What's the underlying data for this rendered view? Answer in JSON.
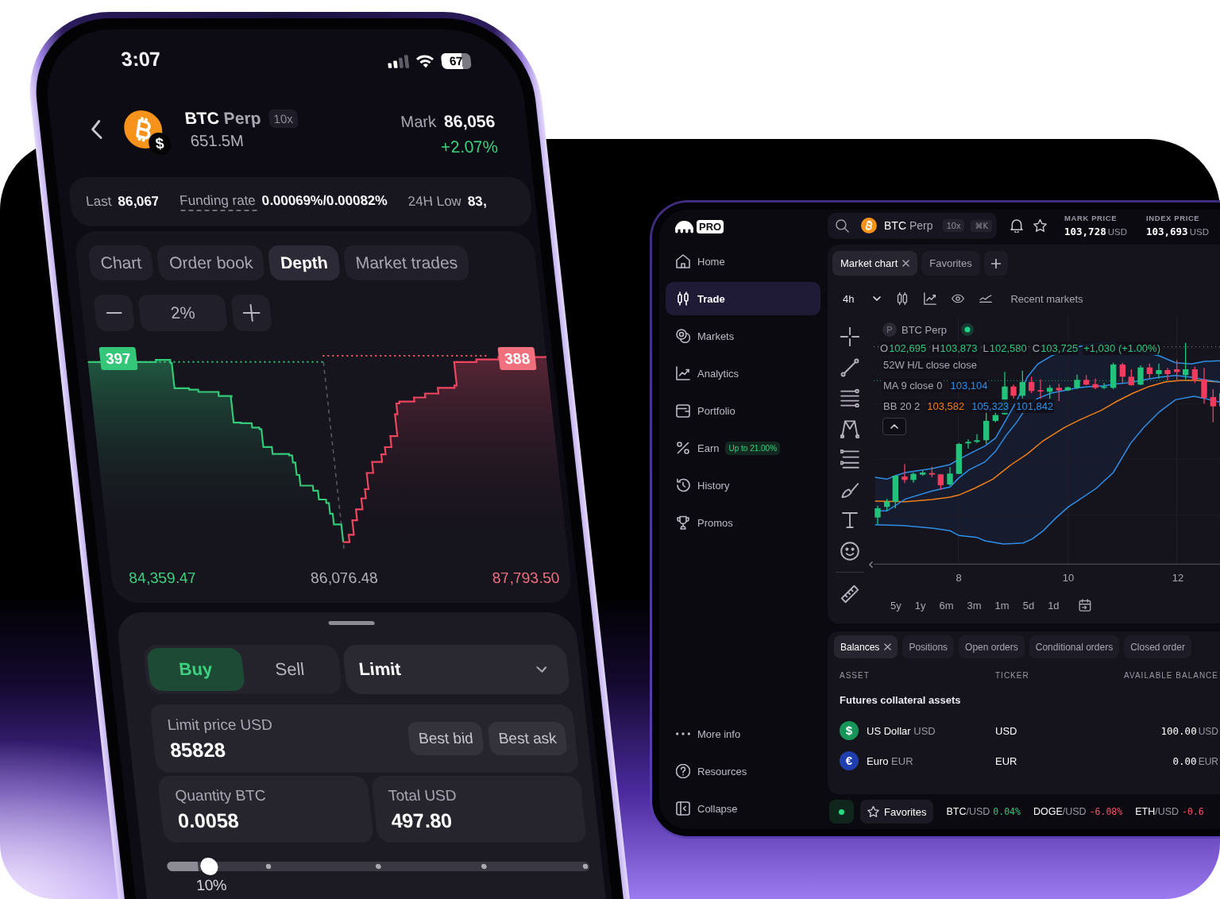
{
  "phone": {
    "status_bar": {
      "time": "3:07",
      "battery": "67"
    },
    "header": {
      "base": "BTC",
      "quote": "Perp",
      "coin_badge": "$",
      "leverage": "10x",
      "volume": "651.5M",
      "mark_label": "Mark",
      "mark_value": "86,056",
      "change": {
        "text": "+2.07%",
        "positive": true
      }
    },
    "stats": [
      {
        "label": "Last",
        "value": "86,067",
        "underlined": false
      },
      {
        "label": "Funding rate",
        "value": "0.00069%/0.00082%",
        "underlined": true
      },
      {
        "label": "24H Low",
        "value": "83,",
        "underlined": false
      }
    ],
    "tabs": [
      {
        "label": "Chart",
        "selected": false
      },
      {
        "label": "Order book",
        "selected": false
      },
      {
        "label": "Depth",
        "selected": true
      },
      {
        "label": "Market trades",
        "selected": false
      }
    ],
    "depth_step": "2%",
    "depth_chart": {
      "bid_label": "397",
      "ask_label": "388",
      "low_price": "84,359.47",
      "mid_price": "86,076.48",
      "high_price": "87,793.50"
    },
    "order_form": {
      "sides": [
        {
          "label": "Buy",
          "kind": "buy",
          "selected": true
        },
        {
          "label": "Sell",
          "kind": "sell",
          "selected": false
        }
      ],
      "order_type": "Limit",
      "limit_price": {
        "label": "Limit price USD",
        "value": "85828",
        "buttons": [
          "Best bid",
          "Best ask"
        ]
      },
      "quantity": {
        "label": "Quantity BTC",
        "value": "0.0058"
      },
      "total": {
        "label": "Total USD",
        "value": "497.80"
      },
      "size_slider": {
        "level": 0.1,
        "reading": "10%"
      }
    }
  },
  "terminal": {
    "logo": {
      "badge": "PRO"
    },
    "sidebar": {
      "items": [
        {
          "label": "Home",
          "selected": false
        },
        {
          "label": "Trade",
          "selected": true
        },
        {
          "label": "Markets",
          "selected": false
        },
        {
          "label": "Analytics",
          "selected": false
        },
        {
          "label": "Portfolio",
          "selected": false
        },
        {
          "label": "Earn",
          "selected": false,
          "badge": "Up to 21.00%"
        },
        {
          "label": "History",
          "selected": false
        },
        {
          "label": "Promos",
          "selected": false
        }
      ],
      "footer_items": [
        "More info",
        "Resources",
        "Collapse"
      ]
    },
    "search": {
      "base": "BTC",
      "quote": "Perp",
      "leverage": "10x",
      "shortcut": "⌘K"
    },
    "prices": [
      {
        "label": "MARK PRICE",
        "value": "103,728",
        "unit": "USD"
      },
      {
        "label": "INDEX PRICE",
        "value": "103,693",
        "unit": "USD"
      }
    ],
    "chart_panel": {
      "tabs": [
        {
          "label": "Market chart",
          "selected": true,
          "closable": true
        },
        {
          "label": "Favorites",
          "selected": false,
          "closable": false
        }
      ],
      "interval": "4h",
      "recent_markets": "Recent markets",
      "legend": {
        "badge": "P",
        "symbol": "BTC Perp",
        "positive": true,
        "ohlc": [
          {
            "key": "O",
            "value": "102,695"
          },
          {
            "key": "H",
            "value": "103,873"
          },
          {
            "key": "L",
            "value": "102,580"
          },
          {
            "key": "C",
            "value": "103,725"
          }
        ],
        "change": "+1,030 (+1.00%)",
        "lines": [
          {
            "label": "52W H/L close close"
          },
          {
            "label": "MA 9 close 0",
            "values": [
              {
                "text": "103,104",
                "color": "#2f8ee6"
              }
            ]
          },
          {
            "label": "BB 20 2",
            "values": [
              {
                "text": "103,582",
                "color": "#f07f1a"
              },
              {
                "text": "105,323",
                "color": "#2f8ee6"
              },
              {
                "text": "101,842",
                "color": "#2f8ee6"
              }
            ]
          }
        ]
      },
      "x_labels": [
        "8",
        "10",
        "12"
      ],
      "ranges": [
        "5y",
        "1y",
        "6m",
        "3m",
        "1m",
        "5d",
        "1d"
      ]
    },
    "balances_panel": {
      "tabs": [
        {
          "label": "Balances",
          "selected": true,
          "closable": true
        },
        {
          "label": "Positions",
          "selected": false,
          "closable": false
        },
        {
          "label": "Open orders",
          "selected": false,
          "closable": false
        },
        {
          "label": "Conditional orders",
          "selected": false,
          "closable": false
        },
        {
          "label": "Closed order",
          "selected": false,
          "closable": false
        }
      ],
      "columns": [
        "ASSET",
        "TICKER",
        "AVAILABLE BALANCE"
      ],
      "section": "Futures collateral assets",
      "rows": [
        {
          "symbol": "$",
          "color": "#17965a",
          "name": "US Dollar",
          "code": "USD",
          "ticker": "USD",
          "amount": "100.00",
          "unit": "USD"
        },
        {
          "symbol": "€",
          "color": "#1f3fae",
          "name": "Euro",
          "code": "EUR",
          "ticker": "EUR",
          "amount": "0.00",
          "unit": "EUR"
        }
      ]
    },
    "status_bar": {
      "favorites": "Favorites",
      "tickers": [
        {
          "base": "BTC",
          "quote": "/USD",
          "change": "0.04%",
          "positive": true
        },
        {
          "base": "DOGE",
          "quote": "/USD",
          "change": "-6.08%",
          "positive": false
        },
        {
          "base": "ETH",
          "quote": "/USD",
          "change": "-0.6",
          "positive": false
        }
      ]
    }
  }
}
